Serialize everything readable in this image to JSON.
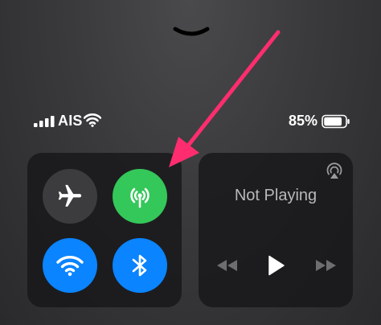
{
  "status_bar": {
    "carrier": "AIS",
    "battery_percent": "85%",
    "signal_bars": 4,
    "signal_icon": "cellular-signal-icon",
    "wifi_icon": "wifi-icon",
    "battery_icon": "battery-icon",
    "battery_level": 0.85
  },
  "connectivity": {
    "airplane": {
      "icon": "airplane-icon",
      "state": "off",
      "color": "#3c3c3e"
    },
    "cellular": {
      "icon": "cellular-antenna-icon",
      "state": "on",
      "color": "#34c759"
    },
    "wifi": {
      "icon": "wifi-icon",
      "state": "on",
      "color": "#0a84ff"
    },
    "bluetooth": {
      "icon": "bluetooth-icon",
      "state": "on",
      "color": "#0a84ff"
    }
  },
  "media": {
    "title": "Not Playing",
    "airplay_icon": "airplay-icon",
    "controls": [
      "rewind-icon",
      "play-icon",
      "fast-forward-icon"
    ]
  },
  "annotation": {
    "arrow_color": "#ff2d6f",
    "icon": "pointer-arrow-icon"
  },
  "dismiss_icon": "chevron-down-icon"
}
